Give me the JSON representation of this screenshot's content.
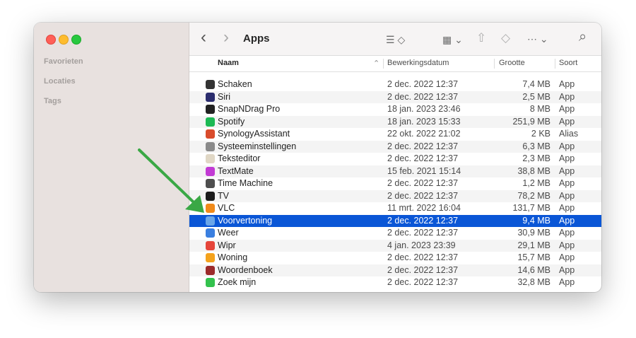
{
  "window": {
    "title": "Apps",
    "sidebar": {
      "favorites": "Favorieten",
      "locations": "Locaties",
      "tags": "Tags"
    },
    "toolbar": {
      "back": "‹",
      "forward": "›",
      "view_icon": "☰ ◇",
      "group_icon": "▦ ⌄",
      "share_icon": "⇧",
      "tag_icon": "◇",
      "more_icon": "⋯ ⌄",
      "search_icon": "⌕"
    },
    "columns": {
      "name": "Naam",
      "date": "Bewerkingsdatum",
      "size": "Grootte",
      "kind": "Soort"
    },
    "rows": [
      {
        "name": "Schaken",
        "date": "2 dec. 2022 12:37",
        "size": "7,4 MB",
        "kind": "App",
        "icon": "chess-icon",
        "color": "#333333"
      },
      {
        "name": "Siri",
        "date": "2 dec. 2022 12:37",
        "size": "2,5 MB",
        "kind": "App",
        "icon": "siri-icon",
        "color": "#2b2d6e"
      },
      {
        "name": "SnapNDrag Pro",
        "date": "18 jan. 2023 23:46",
        "size": "8 MB",
        "kind": "App",
        "icon": "snapndrag-icon",
        "color": "#222222"
      },
      {
        "name": "Spotify",
        "date": "18 jan. 2023 15:33",
        "size": "251,9 MB",
        "kind": "App",
        "icon": "spotify-icon",
        "color": "#1db954"
      },
      {
        "name": "SynologyAssistant",
        "date": "22 okt. 2022 21:02",
        "size": "2 KB",
        "kind": "Alias",
        "icon": "synology-icon",
        "color": "#d94c2c"
      },
      {
        "name": "Systeeminstellingen",
        "date": "2 dec. 2022 12:37",
        "size": "6,3 MB",
        "kind": "App",
        "icon": "settings-icon",
        "color": "#8a8a8a"
      },
      {
        "name": "Teksteditor",
        "date": "2 dec. 2022 12:37",
        "size": "2,3 MB",
        "kind": "App",
        "icon": "textedit-icon",
        "color": "#e0d7c5"
      },
      {
        "name": "TextMate",
        "date": "15 feb. 2021 15:14",
        "size": "38,8 MB",
        "kind": "App",
        "icon": "textmate-icon",
        "color": "#c23bd4"
      },
      {
        "name": "Time Machine",
        "date": "2 dec. 2022 12:37",
        "size": "1,2 MB",
        "kind": "App",
        "icon": "time-machine-icon",
        "color": "#4e4e4e"
      },
      {
        "name": "TV",
        "date": "2 dec. 2022 12:37",
        "size": "78,2 MB",
        "kind": "App",
        "icon": "tv-icon",
        "color": "#1c1c1c"
      },
      {
        "name": "VLC",
        "date": "11 mrt. 2022 16:04",
        "size": "131,7 MB",
        "kind": "App",
        "icon": "vlc-icon",
        "color": "#f08a1a"
      },
      {
        "name": "Voorvertoning",
        "date": "2 dec. 2022 12:37",
        "size": "9,4 MB",
        "kind": "App",
        "icon": "preview-icon",
        "color": "#6aa6e8",
        "selected": true
      },
      {
        "name": "Weer",
        "date": "2 dec. 2022 12:37",
        "size": "30,9 MB",
        "kind": "App",
        "icon": "weather-icon",
        "color": "#3a7fe0"
      },
      {
        "name": "Wipr",
        "date": "4 jan. 2023 23:39",
        "size": "29,1 MB",
        "kind": "App",
        "icon": "wipr-icon",
        "color": "#e5453a"
      },
      {
        "name": "Woning",
        "date": "2 dec. 2022 12:37",
        "size": "15,7 MB",
        "kind": "App",
        "icon": "home-icon",
        "color": "#f4a21c"
      },
      {
        "name": "Woordenboek",
        "date": "2 dec. 2022 12:37",
        "size": "14,6 MB",
        "kind": "App",
        "icon": "dictionary-icon",
        "color": "#9c2a2a"
      },
      {
        "name": "Zoek mijn",
        "date": "2 dec. 2022 12:37",
        "size": "32,8 MB",
        "kind": "App",
        "icon": "find-my-icon",
        "color": "#33c24d"
      }
    ]
  },
  "annotation": {
    "arrow_color": "#3aa845"
  }
}
